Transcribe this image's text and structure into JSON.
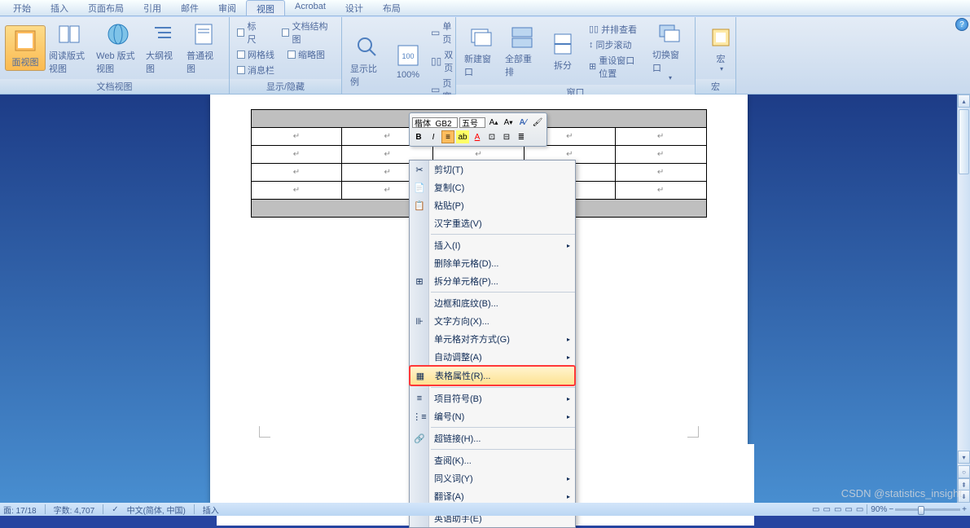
{
  "tabs": [
    "开始",
    "插入",
    "页面布局",
    "引用",
    "邮件",
    "审阅",
    "视图",
    "Acrobat",
    "设计",
    "布局"
  ],
  "active_tab": 6,
  "ribbon": {
    "groups": [
      {
        "label": "文档视图",
        "buttons": [
          "面视图",
          "阅读版式视图",
          "Web 版式视图",
          "大纲视图",
          "普通视图"
        ]
      },
      {
        "label": "显示/隐藏",
        "checks": [
          "标尺",
          "网格线",
          "消息栏",
          "文档结构图",
          "缩略图"
        ]
      },
      {
        "label": "显示比例",
        "buttons": [
          "显示比例",
          "100%"
        ],
        "small": [
          "单页",
          "双页",
          "页宽"
        ]
      },
      {
        "label": "窗口",
        "buttons": [
          "新建窗口",
          "全部重排",
          "拆分"
        ],
        "small": [
          "并排查看",
          "同步滚动",
          "重设窗口位置"
        ],
        "side": "切换窗口"
      },
      {
        "label": "宏",
        "buttons": [
          "宏"
        ]
      }
    ]
  },
  "mini_toolbar": {
    "font": "楷体_GB2",
    "size": "五号",
    "buttons_r1": [
      "A",
      "A",
      "A⁄",
      "✓"
    ],
    "buttons_r2": [
      "B",
      "I",
      "≡",
      "highlight",
      "A",
      "fmt",
      "indent",
      "list"
    ]
  },
  "context_menu": [
    {
      "icon": "✂",
      "label": "剪切(T)"
    },
    {
      "icon": "📄",
      "label": "复制(C)"
    },
    {
      "icon": "📋",
      "label": "粘贴(P)"
    },
    {
      "label": "汉字重选(V)"
    },
    {
      "rule": true
    },
    {
      "label": "插入(I)",
      "arrow": true
    },
    {
      "label": "删除单元格(D)..."
    },
    {
      "icon": "⊞",
      "label": "拆分单元格(P)..."
    },
    {
      "rule": true
    },
    {
      "label": "边框和底纹(B)..."
    },
    {
      "icon": "⊪",
      "label": "文字方向(X)..."
    },
    {
      "label": "单元格对齐方式(G)",
      "arrow": true
    },
    {
      "label": "自动调整(A)",
      "arrow": true
    },
    {
      "icon": "▦",
      "label": "表格属性(R)...",
      "highlight": true,
      "boxed": true
    },
    {
      "rule": true
    },
    {
      "icon": "≡",
      "label": "项目符号(B)",
      "arrow": true
    },
    {
      "icon": "⋮≡",
      "label": "编号(N)",
      "arrow": true
    },
    {
      "rule": true
    },
    {
      "icon": "🔗",
      "label": "超链接(H)..."
    },
    {
      "rule": true
    },
    {
      "label": "查阅(K)..."
    },
    {
      "label": "同义词(Y)",
      "arrow": true
    },
    {
      "label": "翻译(A)",
      "arrow": true
    },
    {
      "rule": true
    },
    {
      "label": "英语助手(E)"
    }
  ],
  "statusbar": {
    "page": "面: 17/18",
    "words": "字数: 4,707",
    "lang": "中文(简体, 中国)",
    "mode": "插入",
    "zoom": "90%"
  },
  "watermark": "CSDN @statistics_insight"
}
